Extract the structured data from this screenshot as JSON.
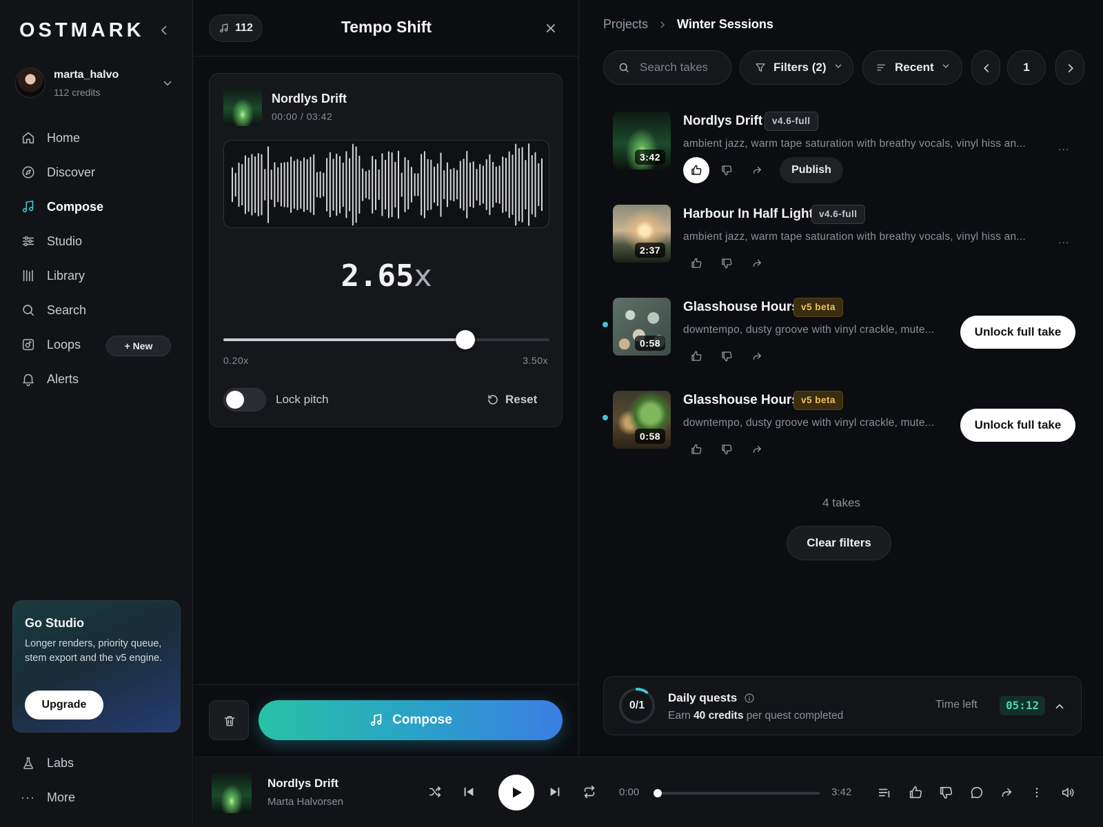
{
  "sidebar": {
    "logo": "OSTMARK",
    "user": {
      "name": "marta_halvo",
      "credits": "112 credits"
    },
    "nav": [
      {
        "label": "Home",
        "icon": "home-icon"
      },
      {
        "label": "Discover",
        "icon": "compass-icon"
      },
      {
        "label": "Compose",
        "icon": "music-note-icon",
        "active": true
      },
      {
        "label": "Studio",
        "icon": "sliders-icon"
      },
      {
        "label": "Library",
        "icon": "library-icon"
      },
      {
        "label": "Search",
        "icon": "search-icon"
      },
      {
        "label": "Loops",
        "icon": "loop-icon",
        "badge": "+ New"
      },
      {
        "label": "Alerts",
        "icon": "bell-icon"
      }
    ],
    "promo": {
      "title": "Go Studio",
      "text": "Longer renders, priority queue, stem export and the v5 engine.",
      "button": "Upgrade"
    },
    "bottom_nav": [
      {
        "label": "Labs",
        "icon": "flask-icon"
      },
      {
        "label": "More",
        "icon": "more-horizontal-icon",
        "glyph": "···"
      }
    ]
  },
  "editor": {
    "credit_count": "112",
    "title": "Tempo Shift",
    "track": {
      "name": "Nordlys Drift",
      "time": "00:00 / 03:42"
    },
    "speed_value": "2.65",
    "speed_unit": "x",
    "slider": {
      "min_label": "0.20x",
      "max_label": "3.50x",
      "min": 0.2,
      "max": 3.5,
      "value": 2.65
    },
    "lock_pitch_label": "Lock pitch",
    "lock_pitch_on": false,
    "reset_label": "Reset",
    "compose_label": "Compose"
  },
  "breadcrumb": {
    "parent": "Projects",
    "current": "Winter Sessions"
  },
  "toolbar": {
    "search_placeholder": "Search takes",
    "filters_label": "Filters (2)",
    "sort_label": "Recent",
    "page": "1"
  },
  "takes": [
    {
      "title": "Nordlys Drift",
      "version": "v4.6-full",
      "version_type": "full",
      "desc": "ambient jazz, warm tape saturation with breathy vocals, vinyl hiss an...",
      "duration": "3:42",
      "art": "aurora",
      "liked": true,
      "publish": "Publish",
      "more": "...",
      "new": false
    },
    {
      "title": "Harbour In Half Light",
      "version": "v4.6-full",
      "version_type": "full",
      "desc": "ambient jazz, warm tape saturation with breathy vocals, vinyl hiss an...",
      "duration": "2:37",
      "art": "harbour",
      "liked": false,
      "more": "...",
      "new": false
    },
    {
      "title": "Glasshouse Hours",
      "version": "v5 beta",
      "version_type": "beta",
      "desc": "downtempo, dusty groove with vinyl crackle, mute...",
      "duration": "0:58",
      "art": "cactus",
      "liked": false,
      "unlock": "Unlock full take",
      "new": true
    },
    {
      "title": "Glasshouse Hours",
      "version": "v5 beta",
      "version_type": "beta",
      "desc": "downtempo, dusty groove with vinyl crackle, mute...",
      "duration": "0:58",
      "art": "greenhouse",
      "liked": false,
      "unlock": "Unlock full take",
      "new": true
    }
  ],
  "take_count": "4 takes",
  "clear_filters": "Clear filters",
  "quests": {
    "progress": "0/1",
    "progress_fraction": 0.1,
    "title": "Daily quests",
    "sub_prefix": "Earn ",
    "sub_bold": "40 credits",
    "sub_suffix": " per quest completed",
    "time_left_label": "Time left",
    "time_left": "05:12"
  },
  "player": {
    "title": "Nordlys Drift",
    "artist": "Marta Halvorsen",
    "current": "0:00",
    "total": "3:42",
    "progress": 0
  },
  "colors": {
    "accent": "#3fc6c6",
    "beta": "#f0c25c",
    "timer": "#4ed6a8"
  }
}
